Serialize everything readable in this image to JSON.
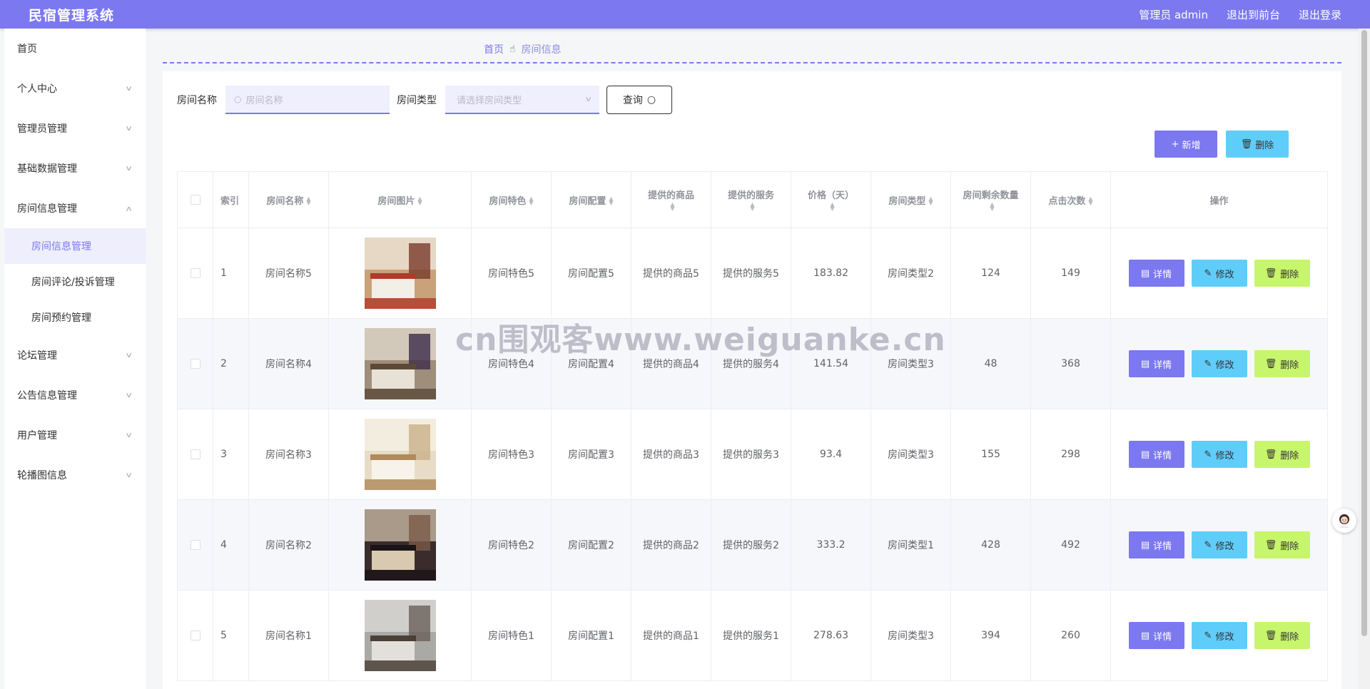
{
  "header": {
    "title": "民宿管理系统",
    "admin_label": "管理员 admin",
    "front_label": "退出到前台",
    "logout_label": "退出登录"
  },
  "sidebar": {
    "items": [
      {
        "label": "首页"
      },
      {
        "label": "个人中心"
      },
      {
        "label": "管理员管理"
      },
      {
        "label": "基础数据管理"
      },
      {
        "label": "房间信息管理"
      },
      {
        "label": "论坛管理"
      },
      {
        "label": "公告信息管理"
      },
      {
        "label": "用户管理"
      },
      {
        "label": "轮播图信息"
      }
    ],
    "sub_items": [
      {
        "label": "房间信息管理"
      },
      {
        "label": "房间评论/投诉管理"
      },
      {
        "label": "房间预约管理"
      }
    ]
  },
  "breadcrumb": {
    "home": "首页",
    "current": "房间信息"
  },
  "search": {
    "name_label": "房间名称",
    "name_placeholder": "房间名称",
    "type_label": "房间类型",
    "type_placeholder": "请选择房间类型",
    "query_label": "查询"
  },
  "actions": {
    "add_label": "新增",
    "delete_label": "删除"
  },
  "table": {
    "headers": [
      "索引",
      "房间名称",
      "房间图片",
      "房间特色",
      "房间配置",
      "提供的商品",
      "提供的服务",
      "价格（天）",
      "房间类型",
      "房间剩余数量",
      "点击次数",
      "操作"
    ],
    "rows": [
      {
        "idx": "1",
        "name": "房间名称5",
        "feature": "房间特色5",
        "config": "房间配置5",
        "goods": "提供的商品5",
        "service": "提供的服务5",
        "price": "183.82",
        "type": "房间类型2",
        "remain": "124",
        "clicks": "149"
      },
      {
        "idx": "2",
        "name": "房间名称4",
        "feature": "房间特色4",
        "config": "房间配置4",
        "goods": "提供的商品4",
        "service": "提供的服务4",
        "price": "141.54",
        "type": "房间类型3",
        "remain": "48",
        "clicks": "368"
      },
      {
        "idx": "3",
        "name": "房间名称3",
        "feature": "房间特色3",
        "config": "房间配置3",
        "goods": "提供的商品3",
        "service": "提供的服务3",
        "price": "93.4",
        "type": "房间类型3",
        "remain": "155",
        "clicks": "298"
      },
      {
        "idx": "4",
        "name": "房间名称2",
        "feature": "房间特色2",
        "config": "房间配置2",
        "goods": "提供的商品2",
        "service": "提供的服务2",
        "price": "333.2",
        "type": "房间类型1",
        "remain": "428",
        "clicks": "492"
      },
      {
        "idx": "5",
        "name": "房间名称1",
        "feature": "房间特色1",
        "config": "房间配置1",
        "goods": "提供的商品1",
        "service": "提供的服务1",
        "price": "278.63",
        "type": "房间类型3",
        "remain": "394",
        "clicks": "260"
      }
    ],
    "row_actions": {
      "detail": "详情",
      "edit": "修改",
      "delete": "删除"
    }
  },
  "watermark": "cn围观客www.weiguanke.cn",
  "colors": {
    "primary": "#7b78f0",
    "info": "#5fcdf9",
    "lime": "#c7f56b"
  }
}
